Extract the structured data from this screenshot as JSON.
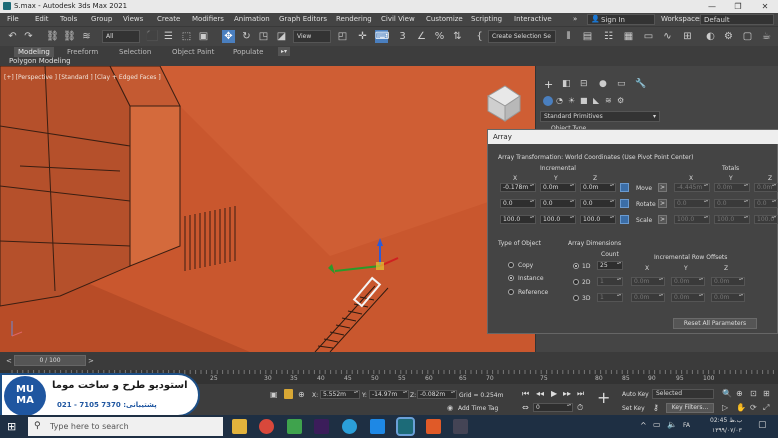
{
  "titlebar": {
    "title": "S.max - Autodesk 3ds Max 2021",
    "minimize": "—",
    "maximize": "❐",
    "close": "✕"
  },
  "menu": [
    "File",
    "Edit",
    "Tools",
    "Group",
    "Views",
    "Create",
    "Modifiers",
    "Animation",
    "Graph Editors",
    "Rendering",
    "Civil View",
    "Customize",
    "Scripting",
    "Interactive"
  ],
  "signin": "Sign In",
  "workspaces_label": "Workspaces:",
  "workspaces_value": "Default",
  "toolbar": {
    "selection_filter": "All",
    "ref_coord": "View",
    "named_sel": "Create Selection Se"
  },
  "ribbon": {
    "tabs": [
      "Modeling",
      "Freeform",
      "Selection",
      "Object Paint",
      "Populate"
    ],
    "sub": "Polygon Modeling"
  },
  "viewport": {
    "label": "[+] [Perspective ] [Standard ] [Clay + Edged Faces ]"
  },
  "cmdpanel": {
    "dropdown": "Standard Primitives",
    "obj_type": "Object Type"
  },
  "dialog": {
    "title": "Array",
    "header": "Array Transformation: World Coordinates (Use Pivot Point Center)",
    "incremental": "Incremental",
    "totals": "Totals",
    "axes": [
      "X",
      "Y",
      "Z"
    ],
    "rows": [
      {
        "name": "Move",
        "inc": [
          "-0.178m",
          "0.0m",
          "0.0m"
        ],
        "tot": [
          "-4.445m",
          "0.0m",
          "0.0m"
        ]
      },
      {
        "name": "Rotate",
        "inc": [
          "0.0",
          "0.0",
          "0.0"
        ],
        "tot": [
          "0.0",
          "0.0",
          "0.0"
        ]
      },
      {
        "name": "Scale",
        "inc": [
          "100.0",
          "100.0",
          "100.0"
        ],
        "tot": [
          "100.0",
          "100.0",
          "100.0"
        ]
      }
    ],
    "arrow": ">",
    "type_of_object": "Type of Object",
    "object_types": [
      "Copy",
      "Instance",
      "Reference"
    ],
    "array_dimensions": "Array Dimensions",
    "count": "Count",
    "inc_row_offsets": "Incremental Row Offsets",
    "dims": [
      {
        "name": "1D",
        "count": "25"
      },
      {
        "name": "2D",
        "count": "1",
        "offs": [
          "0.0m",
          "0.0m",
          "0.0m"
        ]
      },
      {
        "name": "3D",
        "count": "1",
        "offs": [
          "0.0m",
          "0.0m",
          "0.0m"
        ]
      }
    ],
    "reset": "Reset All Parameters"
  },
  "timeline": {
    "frame": "0 / 100",
    "prev": "<",
    "next": ">"
  },
  "ruler": [
    "25",
    "30",
    "35",
    "40",
    "45",
    "50",
    "55",
    "60",
    "65",
    "70",
    "75",
    "80",
    "85",
    "90",
    "95",
    "100"
  ],
  "status": {
    "x": "5.552m",
    "y": "-14.97m",
    "z": "-0.082m",
    "grid": "Grid = 0.254m",
    "add_time_tag": "Add Time Tag",
    "auto_key": "Auto Key",
    "selected": "Selected",
    "set_key": "Set Key",
    "key_filters": "Key Filters...",
    "frame": "0",
    "x_lbl": "X:",
    "y_lbl": "Y:",
    "z_lbl": "Z:"
  },
  "watermark": {
    "logo": "MU\nMA",
    "line1": "استودیو طرح و ساخت موما",
    "line2": "021 - 7105 7370 :پشتیبانی"
  },
  "taskbar": {
    "search": "Type here to search",
    "time": "02:45 ب.ظ",
    "date": "۱۳۹۹/۰۷/۰۳",
    "lang": "FA"
  }
}
